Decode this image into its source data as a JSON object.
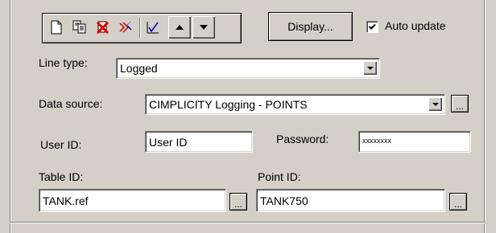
{
  "toolbar": {
    "icons": [
      "new-icon",
      "copy-icon",
      "delete-icon",
      "chart-pen-icon",
      "chart-check-icon",
      "move-up-icon",
      "move-down-icon"
    ]
  },
  "display_button": {
    "label": "Display..."
  },
  "auto_update": {
    "label": "Auto update",
    "checked": true
  },
  "line_type": {
    "label": "Line type:",
    "value": "Logged"
  },
  "data_source": {
    "label": "Data source:",
    "value": "CIMPLICITY Logging - POINTS",
    "browse_label": "..."
  },
  "user_id": {
    "label": "User ID:",
    "value": "User ID"
  },
  "password": {
    "label": "Password:",
    "value": "xxxxxxxx"
  },
  "table_id": {
    "label": "Table ID:",
    "value": "TANK.ref",
    "browse_label": "..."
  },
  "point_id": {
    "label": "Point ID:",
    "value": "TANK750",
    "browse_label": "..."
  },
  "colors": {
    "face": "#d4d0c8",
    "shadow": "#808080",
    "delete_red": "#e00000"
  }
}
